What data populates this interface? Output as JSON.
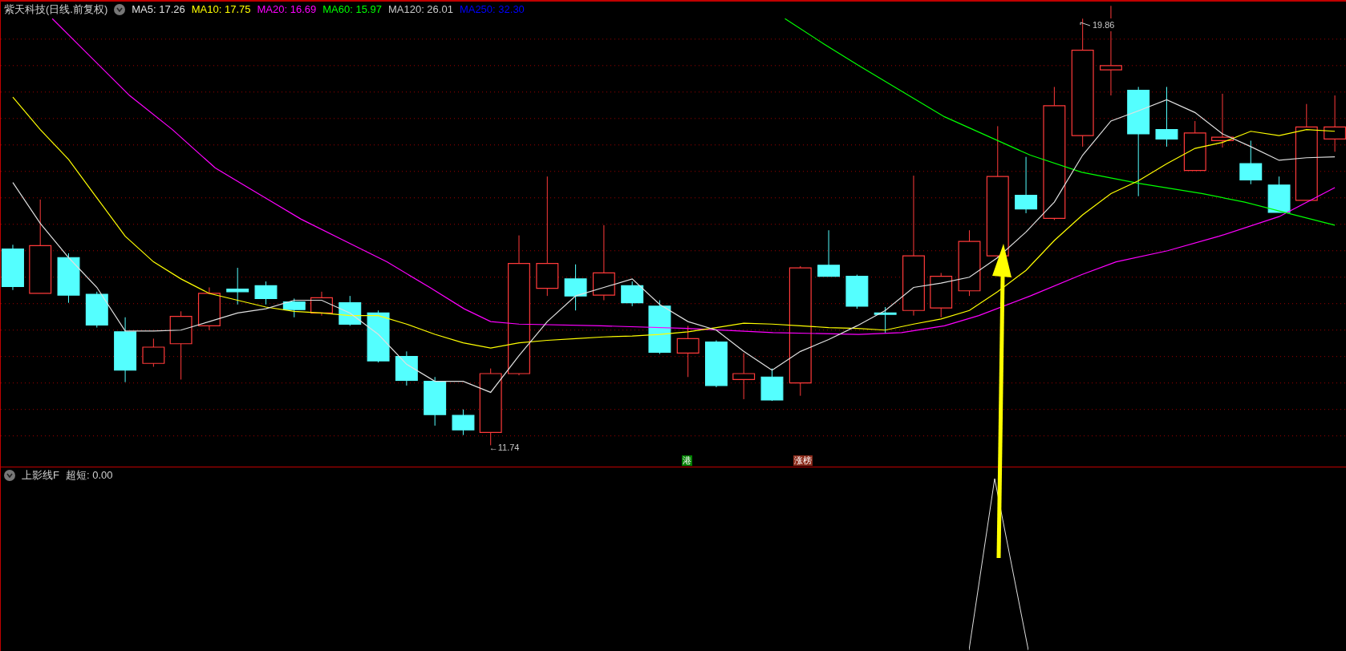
{
  "main_panel": {
    "title": "紫天科技(日线.前复权)",
    "indicators": [
      {
        "label": "MA5: 17.26",
        "color": "#e0e0e0"
      },
      {
        "label": "MA10: 17.75",
        "color": "#ffff00"
      },
      {
        "label": "MA20: 16.69",
        "color": "#ff00ff"
      },
      {
        "label": "MA60: 15.97",
        "color": "#00ff00"
      },
      {
        "label": "MA120: 26.01",
        "color": "#c8c8c8"
      },
      {
        "label": "MA250: 32.30",
        "color": "#0000ff"
      }
    ],
    "high_label": "19.86",
    "low_label": "←11.74",
    "markers": [
      {
        "label": "港",
        "color": "#008000"
      },
      {
        "label": "涨榜",
        "color": "#8b2a1a"
      }
    ]
  },
  "lower_panel": {
    "title": "上影线F",
    "reading": "超短: 0.00"
  }
}
